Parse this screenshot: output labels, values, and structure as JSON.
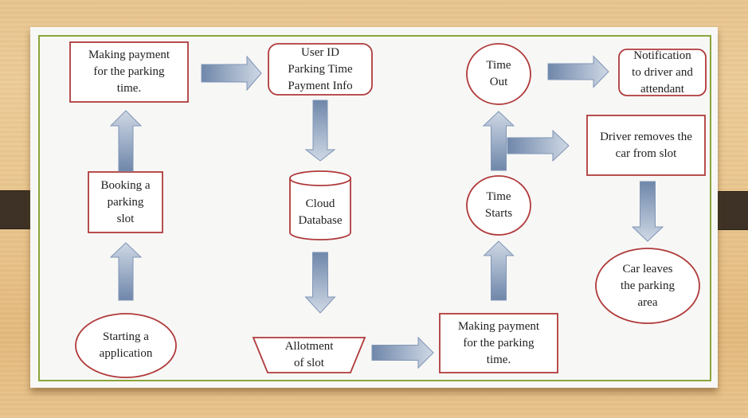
{
  "diagram": {
    "title": "",
    "colors": {
      "node_border": "#b03a3a",
      "node_fill": "#ffffff",
      "arrow_dark": "#6f87aa",
      "arrow_light": "#cfd8e5",
      "arrow_border": "#7f95b5",
      "frame_green": "#8aa63a",
      "paper": "#f7f7f6",
      "tab_brown": "#3e3226"
    },
    "nodes": [
      {
        "id": "start-app",
        "shape": "ellipse",
        "text": "Starting a\napplication"
      },
      {
        "id": "booking-slot",
        "shape": "rectangle",
        "text": "Booking a\nparking\nslot"
      },
      {
        "id": "payment-1",
        "shape": "rectangle",
        "text": "Making payment\nfor the parking\ntime."
      },
      {
        "id": "user-info",
        "shape": "rounded-rectangle",
        "text": "User ID\nParking Time\nPayment Info"
      },
      {
        "id": "cloud-db",
        "shape": "cylinder",
        "text": "Cloud\nDatabase"
      },
      {
        "id": "allotment",
        "shape": "trapezoid",
        "text": "Allotment\nof  slot"
      },
      {
        "id": "payment-2",
        "shape": "rectangle",
        "text": "Making payment\nfor the parking\ntime."
      },
      {
        "id": "time-starts",
        "shape": "ellipse",
        "text": "Time\nStarts"
      },
      {
        "id": "time-out",
        "shape": "ellipse",
        "text": "Time\nOut"
      },
      {
        "id": "notification",
        "shape": "rounded-rectangle",
        "text": "Notification\nto driver and\nattendant"
      },
      {
        "id": "driver-removes",
        "shape": "rectangle",
        "text": "Driver removes the\ncar from slot"
      },
      {
        "id": "car-leaves",
        "shape": "ellipse",
        "text": "Car leaves\nthe parking\narea"
      }
    ],
    "edges": [
      {
        "from": "start-app",
        "to": "booking-slot",
        "direction": "up"
      },
      {
        "from": "booking-slot",
        "to": "payment-1",
        "direction": "up"
      },
      {
        "from": "payment-1",
        "to": "user-info",
        "direction": "right"
      },
      {
        "from": "user-info",
        "to": "cloud-db",
        "direction": "down"
      },
      {
        "from": "cloud-db",
        "to": "allotment",
        "direction": "down"
      },
      {
        "from": "allotment",
        "to": "payment-2",
        "direction": "right"
      },
      {
        "from": "payment-2",
        "to": "time-starts",
        "direction": "up"
      },
      {
        "from": "time-starts",
        "to": "time-out",
        "direction": "up"
      },
      {
        "from": "time-starts",
        "to": "driver-removes",
        "direction": "right"
      },
      {
        "from": "time-out",
        "to": "notification",
        "direction": "right"
      },
      {
        "from": "driver-removes",
        "to": "car-leaves",
        "direction": "down"
      }
    ]
  }
}
